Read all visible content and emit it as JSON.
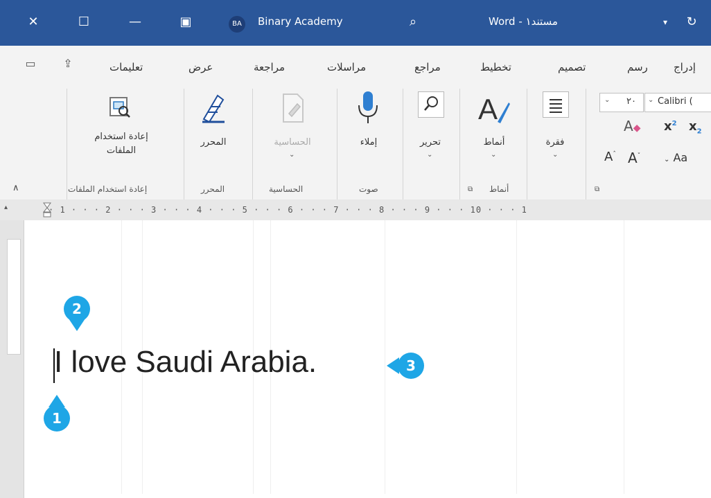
{
  "titlebar": {
    "account_initials": "BA",
    "account_name": "Binary Academy",
    "doc_title": "Word - مستند١",
    "accent": "#2b579a"
  },
  "tabs": {
    "insert": "إدراج",
    "draw": "رسم",
    "design": "تصميم",
    "layout": "تخطيط",
    "references": "مراجع",
    "mailings": "مراسلات",
    "review": "مراجعة",
    "view": "عرض",
    "help": "تعليمات"
  },
  "ribbon": {
    "font_name": "Calibri (",
    "font_size": "٢٠",
    "change_case": "Aa",
    "paragraph": "فقرة",
    "styles_btn": "أنماط",
    "styles_group": "أنماط",
    "editing": "تحرير",
    "dictate_btn": "إملاء",
    "voice_group": "صوت",
    "sensitivity_btn": "الحساسية",
    "sensitivity_group": "الحساسية",
    "editor_btn": "المحرر",
    "editor_group": "المحرر",
    "reuse_files_btn_line1": "إعادة استخدام",
    "reuse_files_btn_line2": "الملفات",
    "reuse_files_group": "إعادة استخدام الملفات"
  },
  "ruler": {
    "marks": "· 1 · · · 2 · · · 3 · · · 4 · · · 5 · · · 6 · · · 7 · · · 8 · · · 9 · · · 10 · · · 1"
  },
  "document": {
    "text": "I love Saudi Arabia."
  },
  "markers": {
    "one": "1",
    "two": "2",
    "three": "3",
    "color": "#1ea6e6"
  }
}
